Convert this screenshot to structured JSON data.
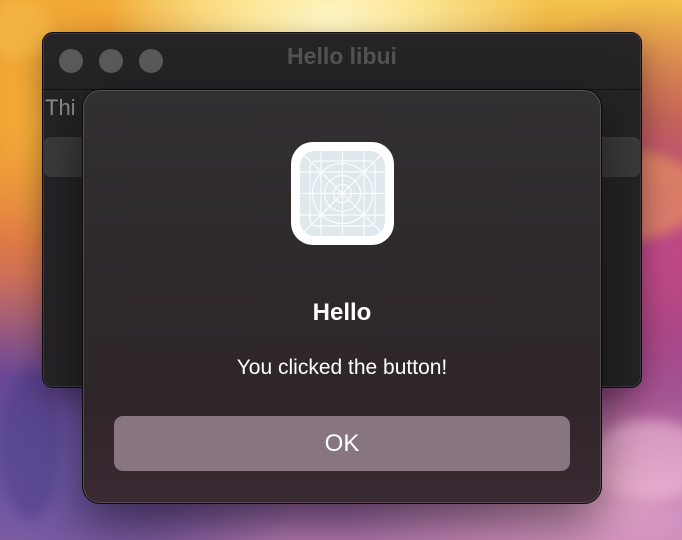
{
  "background_window": {
    "title": "Hello libui",
    "label_text": "Thi"
  },
  "alert": {
    "icon": "generic-app-icon",
    "title": "Hello",
    "message": "You clicked the button!",
    "ok_label": "OK"
  },
  "colors": {
    "window_background": "#252325",
    "dialog_background": "#2f2a2d",
    "button_background": "#877580",
    "text": "#ffffff"
  }
}
